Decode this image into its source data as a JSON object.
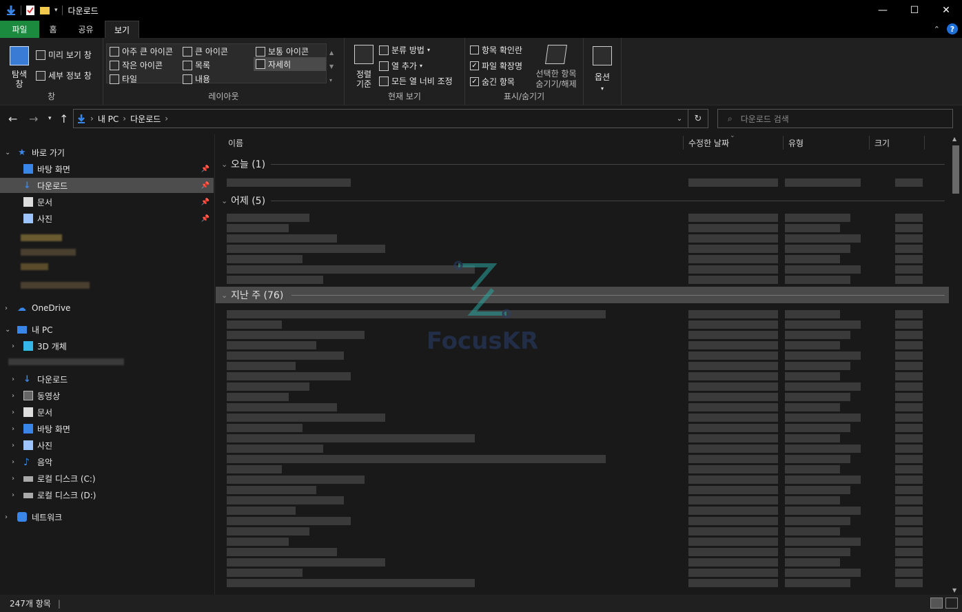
{
  "window": {
    "title": "다운로드",
    "controls": {
      "minimize": "—",
      "maximize": "☐",
      "close": "✕"
    }
  },
  "ribbon_tabs": [
    {
      "label": "파일",
      "kind": "file"
    },
    {
      "label": "홈",
      "kind": "normal"
    },
    {
      "label": "공유",
      "kind": "normal"
    },
    {
      "label": "보기",
      "kind": "active"
    }
  ],
  "ribbon": {
    "pane": {
      "nav_pane_label": "탐색\n창",
      "preview_label": "미리 보기 창",
      "details_label": "세부 정보 창",
      "group_label": "창"
    },
    "layout": {
      "items": [
        "아주 큰 아이콘",
        "큰 아이콘",
        "보통 아이콘",
        "작은 아이콘",
        "목록",
        "자세히",
        "타일",
        "내용"
      ],
      "selected": "자세히",
      "group_label": "레이아웃"
    },
    "current_view": {
      "sort_label": "정렬\n기준",
      "group_by_label": "분류 방법",
      "add_column_label": "열 추가",
      "fit_columns_label": "모든 열 너비 조정",
      "group_label": "현재 보기"
    },
    "show_hide": {
      "item_checkboxes": {
        "label": "항목 확인란",
        "checked": false
      },
      "file_extensions": {
        "label": "파일 확장명",
        "checked": true
      },
      "hidden_items": {
        "label": "숨긴 항목",
        "checked": true
      },
      "hide_selected_label": "선택한 항목\n숨기기/해제",
      "group_label": "표시/숨기기"
    },
    "options_label": "옵션"
  },
  "address": {
    "crumbs": [
      "내 PC",
      "다운로드"
    ],
    "search_placeholder": "다운로드 검색"
  },
  "sidebar": {
    "quick_access": "바로 가기",
    "quick_items": [
      "바탕 화면",
      "다운로드",
      "문서",
      "사진"
    ],
    "onedrive": "OneDrive",
    "this_pc": "내 PC",
    "pc_items": [
      "3D 개체",
      "다운로드",
      "동영상",
      "문서",
      "바탕 화면",
      "사진",
      "음악",
      "로컬 디스크 (C:)",
      "로컬 디스크 (D:)"
    ],
    "network": "네트워크"
  },
  "columns": [
    "이름",
    "수정한 날짜",
    "유형",
    "크기"
  ],
  "groups": [
    {
      "title": "오늘 (1)"
    },
    {
      "title": "어제 (5)"
    },
    {
      "title": "지난 주 (76)"
    }
  ],
  "watermark": "FocusKR",
  "status": {
    "count": "247개 항목"
  },
  "colors": {
    "file_tab": "#1b8a3e",
    "accent": "#1e70d8",
    "selection": "#4d4d4d"
  }
}
